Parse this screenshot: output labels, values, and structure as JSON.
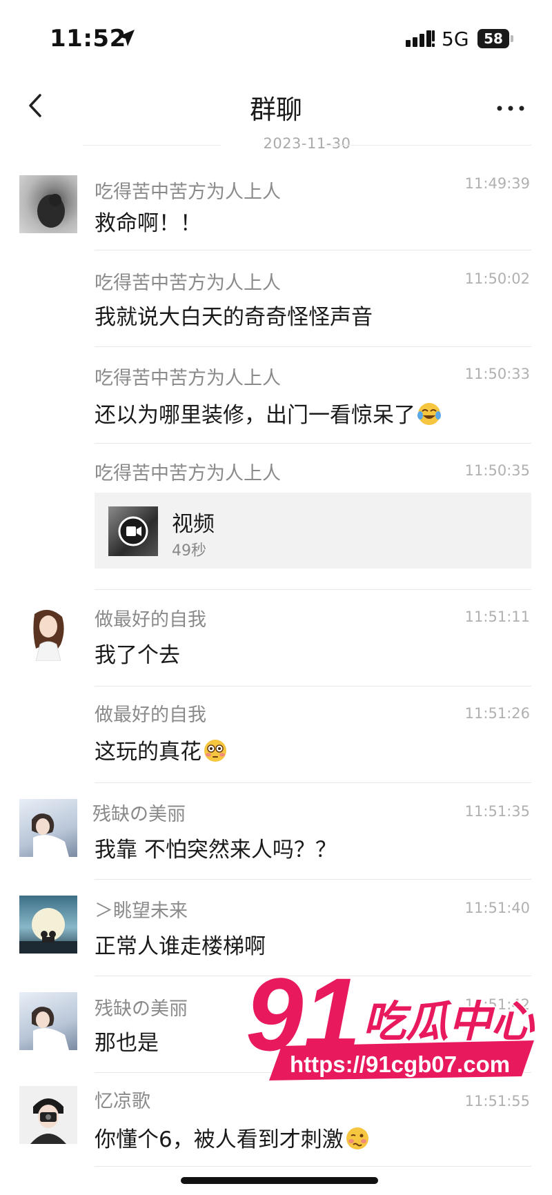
{
  "status_bar": {
    "time": "11:52",
    "network": "5G",
    "battery": "58"
  },
  "nav": {
    "title": "群聊"
  },
  "date_separator": "2023-11-30",
  "messages": [
    {
      "sender": "吃得苦中苦方为人上人",
      "time": "11:49:39",
      "text": "救命啊！！",
      "avatar": "avatar-dark-photo"
    },
    {
      "sender": "吃得苦中苦方为人上人",
      "time": "11:50:02",
      "text": "我就说大白天的奇奇怪怪声音"
    },
    {
      "sender": "吃得苦中苦方为人上人",
      "time": "11:50:33",
      "text": "还以为哪里装修，出门一看惊呆了",
      "emoji": "tears-of-joy-emoji"
    },
    {
      "sender": "吃得苦中苦方为人上人",
      "time": "11:50:35",
      "video": {
        "title": "视频",
        "duration": "49秒"
      }
    },
    {
      "sender": "做最好的自我",
      "time": "11:51:11",
      "text": "我了个去",
      "avatar": "avatar-cartoon-girl"
    },
    {
      "sender": "做最好的自我",
      "time": "11:51:26",
      "text": "这玩的真花",
      "emoji": "flushed-face-emoji"
    },
    {
      "sender": "残缺の美丽",
      "time": "11:51:35",
      "text": "我靠 不怕突然来人吗？？",
      "avatar": "avatar-girl-photo"
    },
    {
      "sender": "＞眺望未来",
      "time": "11:51:40",
      "text": "正常人谁走楼梯啊",
      "avatar": "avatar-moon-couple"
    },
    {
      "sender": "残缺の美丽",
      "time": "11:51:42",
      "text": "那也是",
      "avatar": "avatar-girl-photo"
    },
    {
      "sender": "忆凉歌",
      "time": "11:51:55",
      "text": "你懂个6，被人看到才刺激",
      "emoji": "woozy-face-emoji",
      "avatar": "avatar-boy-camera"
    }
  ],
  "watermark": {
    "number": "91",
    "brand": "吃瓜中心",
    "url": "https://91cgb07.com"
  },
  "colors": {
    "brand": "#e8195c",
    "text": "#1a1a1a",
    "secondary": "#8a8a8a"
  }
}
